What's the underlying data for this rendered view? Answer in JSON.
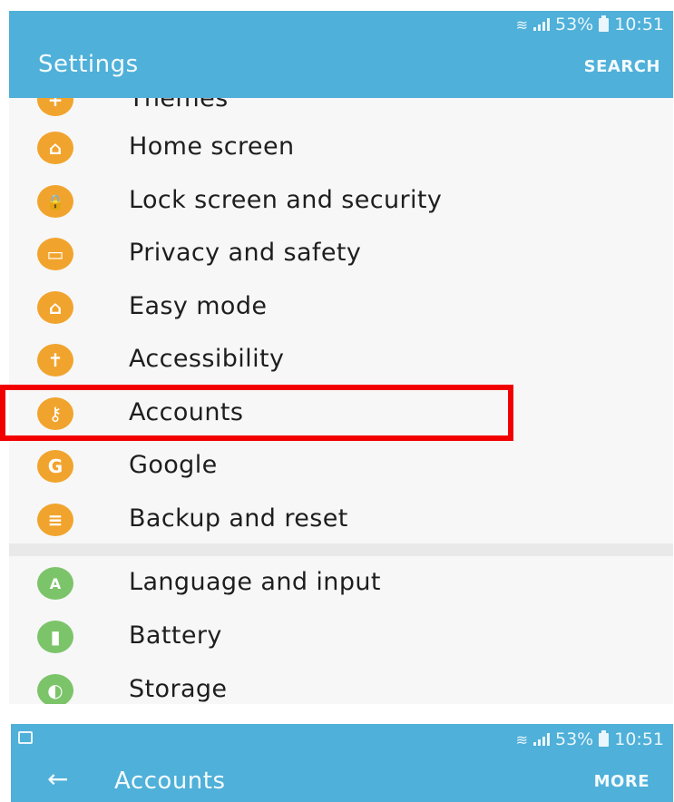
{
  "top": {
    "status": {
      "percent": "53%",
      "time": "10:51"
    },
    "title": "Settings",
    "action": "SEARCH"
  },
  "items": [
    {
      "label": "Themes",
      "color": "orange",
      "icon": "themes-icon",
      "glyph": "+"
    },
    {
      "label": "Home screen",
      "color": "orange",
      "icon": "home-icon",
      "glyph": "⌂"
    },
    {
      "label": "Lock screen and security",
      "color": "orange",
      "icon": "lock-icon",
      "glyph": "🔒"
    },
    {
      "label": "Privacy and safety",
      "color": "orange",
      "icon": "privacy-icon",
      "glyph": "▭"
    },
    {
      "label": "Easy mode",
      "color": "orange",
      "icon": "easy-mode-icon",
      "glyph": "⌂"
    },
    {
      "label": "Accessibility",
      "color": "orange",
      "icon": "accessibility-icon",
      "glyph": "✝"
    },
    {
      "label": "Accounts",
      "color": "orange",
      "icon": "key-icon",
      "glyph": "⚷"
    },
    {
      "label": "Google",
      "color": "orange",
      "icon": "google-icon",
      "glyph": "G"
    },
    {
      "label": "Backup and reset",
      "color": "orange",
      "icon": "backup-icon",
      "glyph": "≡"
    },
    {
      "label": "Language and input",
      "color": "green",
      "icon": "language-icon",
      "glyph": "A"
    },
    {
      "label": "Battery",
      "color": "green",
      "icon": "battery-icon",
      "glyph": "▮"
    },
    {
      "label": "Storage",
      "color": "green",
      "icon": "storage-icon",
      "glyph": "◐"
    }
  ],
  "bottom": {
    "status": {
      "percent": "53%",
      "time": "10:51"
    },
    "title": "Accounts",
    "action": "MORE"
  },
  "colors": {
    "header": "#4fb0d9",
    "orange": "#f1a42d",
    "green": "#7cc46a",
    "highlight": "#f20000"
  }
}
